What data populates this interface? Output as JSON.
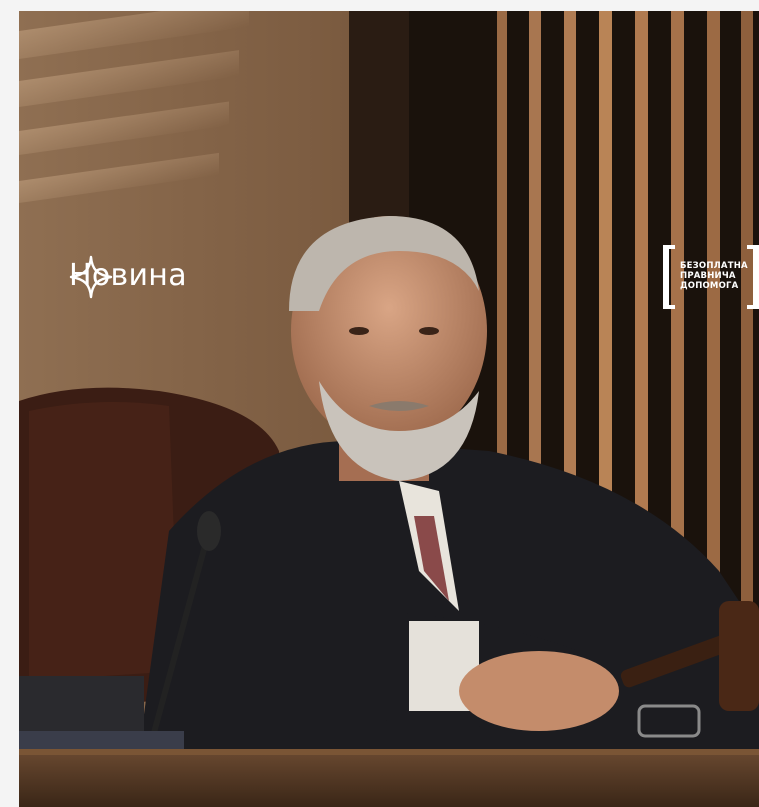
{
  "badge": {
    "icon": "sparkle-star-icon",
    "label": "Новина"
  },
  "logo": {
    "lines": [
      "БЕЗОПЛАТНА",
      "ПРАВНИЧА",
      "ДОПОМОГА"
    ]
  },
  "photo": {
    "subject": "judge-photo",
    "colors": {
      "wall": "#7b5c42",
      "panels": "#1a120d",
      "robe": "#1b1b1e",
      "desk": "#5a3e2a"
    }
  }
}
